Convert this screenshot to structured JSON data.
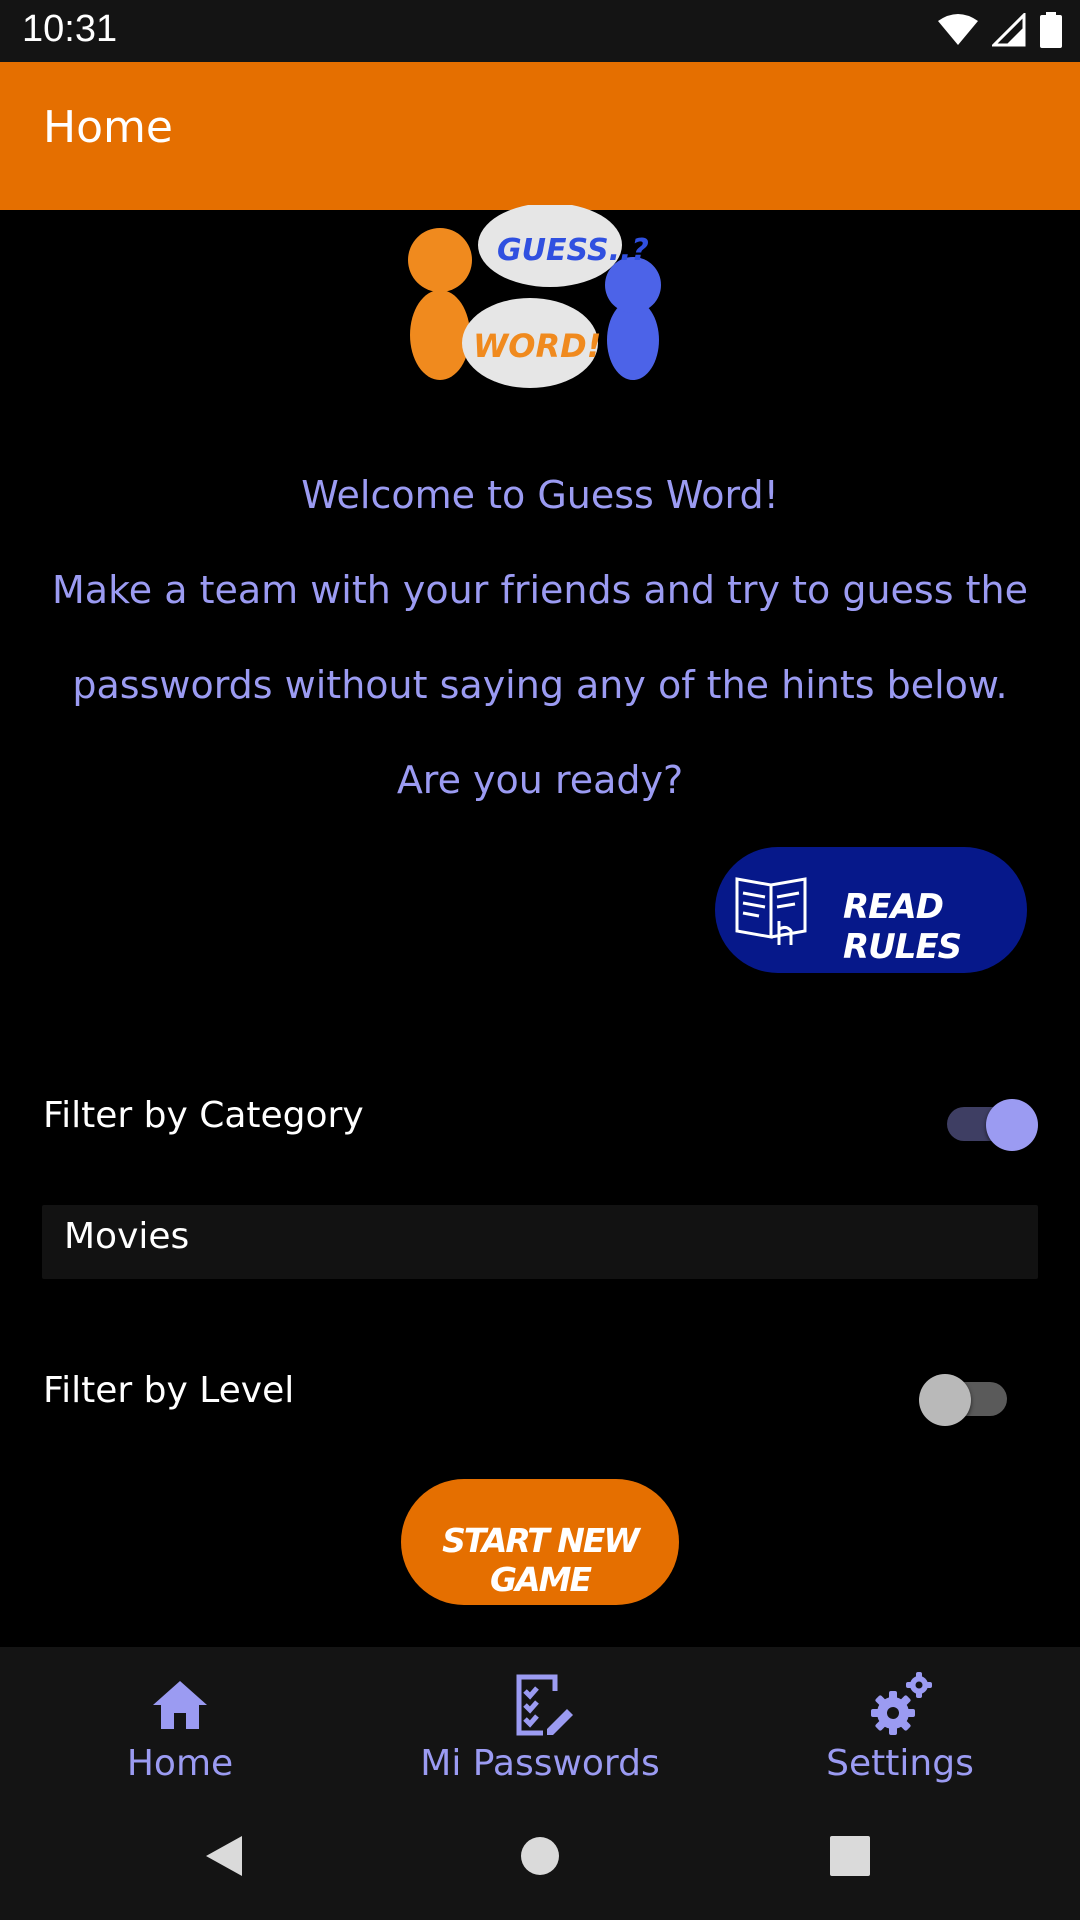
{
  "status_bar": {
    "time": "10:31",
    "icons": [
      "wifi-icon",
      "cellular-signal-icon",
      "battery-icon"
    ]
  },
  "app_bar": {
    "title": "Home",
    "color": "#E56F00"
  },
  "logo": {
    "top_bubble_text": "GUESS..?",
    "bottom_bubble_text": "WORD!"
  },
  "welcome": {
    "line1": "Welcome to Guess Word!",
    "line2": "Make a team with your friends and try to guess the",
    "line3": "passwords without saying any of the hints below.",
    "line4": "Are you ready?",
    "text_color": "#9B9BF2"
  },
  "rules_button": {
    "label": "READ RULES",
    "icon": "rulebook-icon",
    "color": "#06188A"
  },
  "filters": {
    "category": {
      "label": "Filter by Category",
      "enabled": true,
      "selected_value": "Movies"
    },
    "level": {
      "label": "Filter by Level",
      "enabled": false
    }
  },
  "start_button": {
    "label": "START NEW GAME",
    "color": "#E56F00"
  },
  "bottom_nav": {
    "items": [
      {
        "label": "Home",
        "icon": "home-icon"
      },
      {
        "label": "Mi Passwords",
        "icon": "checklist-edit-icon"
      },
      {
        "label": "Settings",
        "icon": "gears-icon"
      }
    ],
    "accent": "#9B9BF2"
  },
  "system_nav": {
    "icons": [
      "back-icon",
      "home-circle-icon",
      "recents-icon"
    ]
  }
}
